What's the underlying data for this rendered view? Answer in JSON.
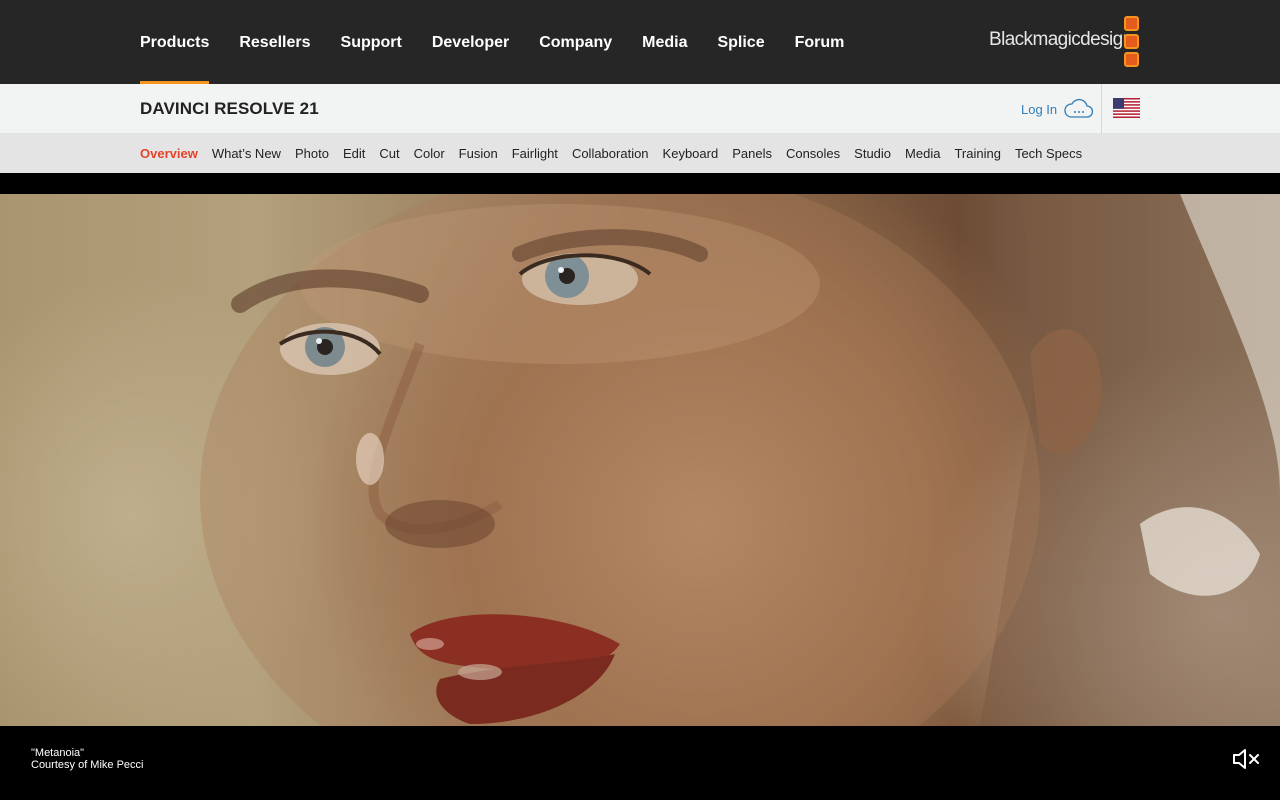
{
  "topnav": {
    "items": [
      {
        "label": "Products",
        "active": true
      },
      {
        "label": "Resellers"
      },
      {
        "label": "Support"
      },
      {
        "label": "Developer"
      },
      {
        "label": "Company"
      },
      {
        "label": "Media"
      },
      {
        "label": "Splice"
      },
      {
        "label": "Forum"
      }
    ],
    "logo_text": "Blackmagicdesign"
  },
  "product": {
    "title": "DAVINCI RESOLVE 21",
    "login_label": "Log In",
    "region_flag": "us-flag-icon"
  },
  "subnav": {
    "items": [
      {
        "label": "Overview",
        "active": true
      },
      {
        "label": "What’s New"
      },
      {
        "label": "Photo"
      },
      {
        "label": "Edit"
      },
      {
        "label": "Cut"
      },
      {
        "label": "Color"
      },
      {
        "label": "Fusion"
      },
      {
        "label": "Fairlight"
      },
      {
        "label": "Collaboration"
      },
      {
        "label": "Keyboard"
      },
      {
        "label": "Panels"
      },
      {
        "label": "Consoles"
      },
      {
        "label": "Studio"
      },
      {
        "label": "Media"
      },
      {
        "label": "Training"
      },
      {
        "label": "Tech Specs"
      }
    ]
  },
  "hero": {
    "caption_title": "\"Metanoia\"",
    "caption_credit": "Courtesy of Mike Pecci",
    "mute_icon": "speaker-muted-icon"
  },
  "colors": {
    "topbar_bg": "#262626",
    "accent_orange": "#f7941d",
    "active_subnav": "#e5432b",
    "link_blue": "#2f7fb9"
  }
}
